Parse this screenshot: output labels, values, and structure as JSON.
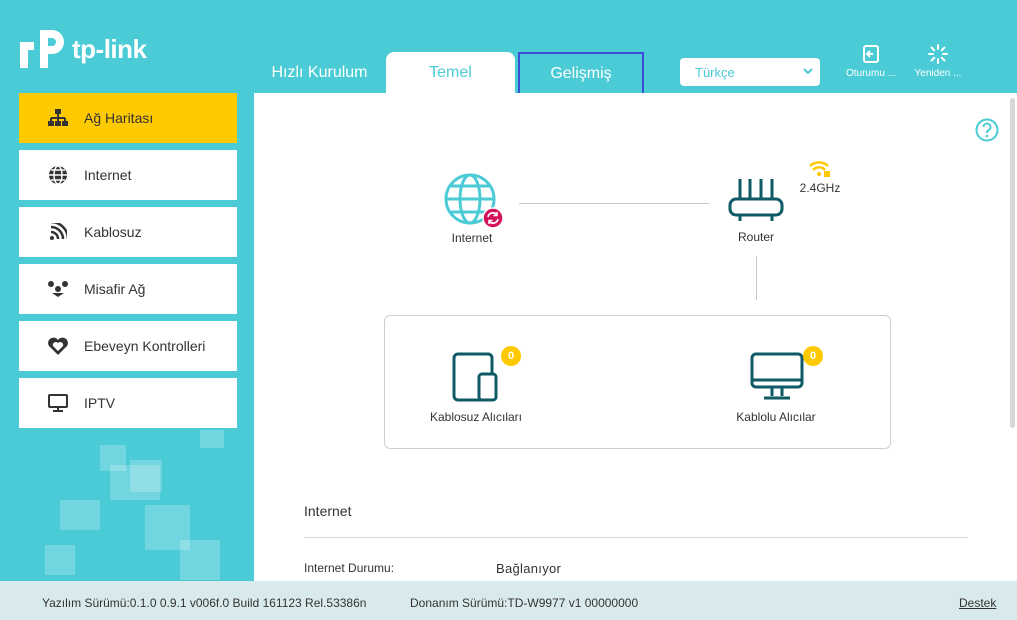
{
  "brand": {
    "logo_text": "tp-link",
    "accent": "#4acbd6",
    "active": "#ffc900"
  },
  "nav": {
    "tabs": [
      {
        "label": "Hızlı Kurulum"
      },
      {
        "label": "Temel"
      },
      {
        "label": "Gelişmiş"
      }
    ],
    "language": "Türkçe",
    "logout_label": "Oturumu ...",
    "reboot_label": "Yeniden ..."
  },
  "sidebar": {
    "items": [
      {
        "label": "Ağ Haritası",
        "icon": "network-map-icon",
        "active": true
      },
      {
        "label": "Internet",
        "icon": "globe-icon"
      },
      {
        "label": "Kablosuz",
        "icon": "wireless-icon"
      },
      {
        "label": "Misafir Ağ",
        "icon": "guest-network-icon"
      },
      {
        "label": "Ebeveyn Kontrolleri",
        "icon": "parental-controls-icon"
      },
      {
        "label": "IPTV",
        "icon": "tv-icon"
      }
    ]
  },
  "map": {
    "internet_label": "Internet",
    "router_label": "Router",
    "band_label": "2.4GHz",
    "wireless_clients_label": "Kablosuz Alıcıları",
    "wireless_clients_count": "0",
    "wired_clients_label": "Kablolu Alıcılar",
    "wired_clients_count": "0"
  },
  "internet_section": {
    "title": "Internet",
    "status_label": "Internet Durumu:",
    "status_value": "Bağlanıyor"
  },
  "footer": {
    "firmware": "Yazılım Sürümü:0.1.0 0.9.1 v006f.0 Build 161123 Rel.53386n",
    "hardware": "Donanım Sürümü:TD-W9977 v1 00000000",
    "support": "Destek"
  }
}
